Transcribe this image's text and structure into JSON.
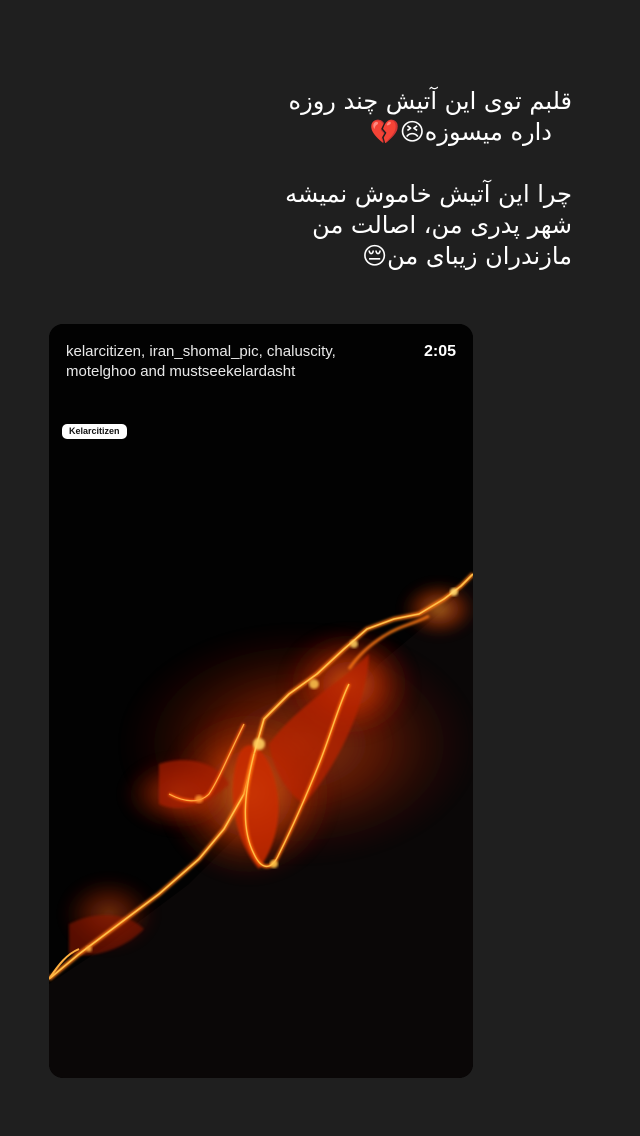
{
  "caption": {
    "lines": [
      "قلبم توی این آتیش چند روزه",
      "داره میسوزه😣💔",
      "چرا این آتیش خاموش نمیشه",
      "شهر پدری من، اصالت من",
      "مازندران زیبای من😔"
    ]
  },
  "shared_post": {
    "accounts_line1": "kelarcitizen, iran_shomal_pic, chaluscity,",
    "accounts_line2": "motelghoo and mustseekelardasht",
    "duration": "2:05",
    "tag": "Kelarcitizen",
    "image_subject": "night-wildfire-on-hillside"
  },
  "colors": {
    "background": "#1f1f1f",
    "card": "#020202",
    "fire_bright": "#ffb030",
    "fire_mid": "#ff5a10",
    "fire_dark": "#b81e00"
  }
}
